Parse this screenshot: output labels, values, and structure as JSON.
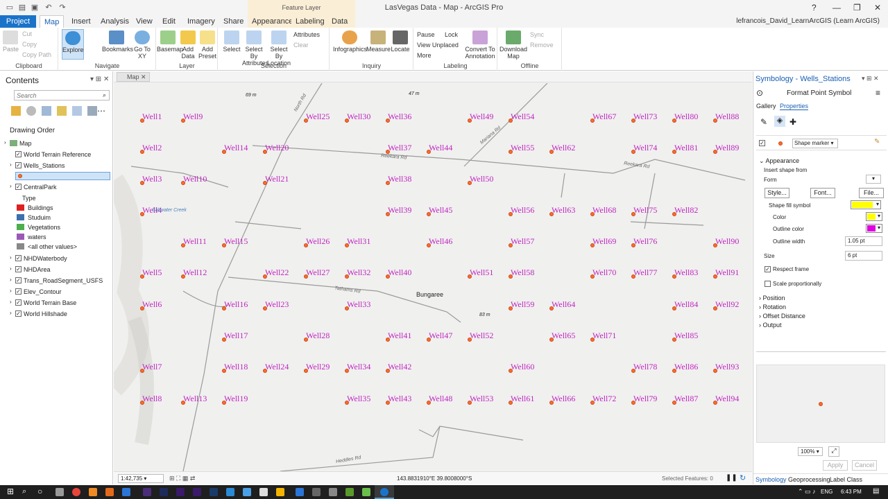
{
  "title_bar": {
    "title": "LasVegas Data - Map - ArcGIS Pro",
    "context_group": "Feature Layer",
    "help": "?",
    "minimize": "—",
    "restore": "❐",
    "close": "✕"
  },
  "tabs": [
    {
      "label": "Project"
    },
    {
      "label": "Map"
    },
    {
      "label": "Insert"
    },
    {
      "label": "Analysis"
    },
    {
      "label": "View"
    },
    {
      "label": "Edit"
    },
    {
      "label": "Imagery"
    },
    {
      "label": "Share"
    },
    {
      "label": "Appearance"
    },
    {
      "label": "Labeling"
    },
    {
      "label": "Data"
    }
  ],
  "user": "lefrancois_David_LearnArcGIS (Learn ArcGIS)",
  "ribbon": {
    "clipboard": {
      "paste": "Paste",
      "cut": "Cut",
      "copy": "Copy",
      "copy_path": "Copy Path",
      "label": "Clipboard"
    },
    "navigate": {
      "explore": "Explore",
      "bookmarks": "Bookmarks",
      "goto": "Go To XY",
      "label": "Navigate"
    },
    "layer": {
      "basemap": "Basemap",
      "add_data": "Add Data",
      "add_preset": "Add Preset",
      "label": "Layer"
    },
    "selection": {
      "select": "Select",
      "select_attr": "Select By Attributes",
      "select_loc": "Select By Location",
      "attributes": "Attributes",
      "clear": "Clear",
      "label": "Selection"
    },
    "inquiry": {
      "infographics": "Infographics",
      "measure": "Measure",
      "locate": "Locate",
      "label": "Inquiry"
    },
    "labeling": {
      "pause": "Pause",
      "lock": "Lock",
      "view_unplaced": "View Unplaced",
      "more": "More",
      "convert": "Convert To Annotation",
      "label": "Labeling"
    },
    "offline": {
      "download": "Download Map",
      "sync": "Sync",
      "remove": "Remove",
      "label": "Offline"
    }
  },
  "contents": {
    "title": "Contents",
    "search_placeholder": "Search",
    "drawing_order": "Drawing Order",
    "layers": [
      {
        "name": "Map"
      },
      {
        "name": "World Terrain Reference"
      },
      {
        "name": "Wells_Stations"
      },
      {
        "name": "CentralPark"
      },
      {
        "name": "Type"
      },
      {
        "name": "Buildings",
        "color": "#e02020"
      },
      {
        "name": "Studuim",
        "color": "#3b6fb0"
      },
      {
        "name": "Vegetations",
        "color": "#4caf4c"
      },
      {
        "name": "waters",
        "color": "#9b59b6"
      },
      {
        "name": "<all other values>",
        "color": "#888888"
      },
      {
        "name": "NHDWaterbody"
      },
      {
        "name": "NHDArea"
      },
      {
        "name": "Trans_RoadSegment_USFS"
      },
      {
        "name": "Elev_Contour"
      },
      {
        "name": "World Terrain Base"
      },
      {
        "name": "World Hillshade"
      }
    ]
  },
  "map": {
    "tab": "Map",
    "place": "Bungaree",
    "scale": "1:42,735",
    "coords": "143.8831910°E 39.8008000°S",
    "selected": "Selected Features: 0",
    "roads": [
      {
        "name": "Reekara Rd"
      },
      {
        "name": "Reekara Rd"
      },
      {
        "name": "Tathams Rd"
      },
      {
        "name": "Heddles Rd"
      },
      {
        "name": "North Rd"
      },
      {
        "name": "Mariana Rd"
      },
      {
        "name": "Saltwater Creek"
      }
    ],
    "elevations": [
      {
        "label": "69 m"
      },
      {
        "label": "47 m"
      },
      {
        "label": "83 m"
      }
    ],
    "wells": [
      {
        "l": "Well1",
        "c": 0,
        "r": 0
      },
      {
        "l": "Well9",
        "c": 1,
        "r": 0
      },
      {
        "l": "Well25",
        "c": 4,
        "r": 0
      },
      {
        "l": "Well30",
        "c": 5,
        "r": 0
      },
      {
        "l": "Well36",
        "c": 6,
        "r": 0
      },
      {
        "l": "Well49",
        "c": 8,
        "r": 0
      },
      {
        "l": "Well54",
        "c": 9,
        "r": 0
      },
      {
        "l": "Well67",
        "c": 11,
        "r": 0
      },
      {
        "l": "Well73",
        "c": 12,
        "r": 0
      },
      {
        "l": "Well80",
        "c": 13,
        "r": 0
      },
      {
        "l": "Well88",
        "c": 14,
        "r": 0
      },
      {
        "l": "Well2",
        "c": 0,
        "r": 1
      },
      {
        "l": "Well14",
        "c": 2,
        "r": 1
      },
      {
        "l": "Well20",
        "c": 3,
        "r": 1
      },
      {
        "l": "Well37",
        "c": 6,
        "r": 1
      },
      {
        "l": "Well44",
        "c": 7,
        "r": 1
      },
      {
        "l": "Well55",
        "c": 9,
        "r": 1
      },
      {
        "l": "Well62",
        "c": 10,
        "r": 1
      },
      {
        "l": "Well74",
        "c": 12,
        "r": 1
      },
      {
        "l": "Well81",
        "c": 13,
        "r": 1
      },
      {
        "l": "Well89",
        "c": 14,
        "r": 1
      },
      {
        "l": "Well3",
        "c": 0,
        "r": 2
      },
      {
        "l": "Well10",
        "c": 1,
        "r": 2
      },
      {
        "l": "Well21",
        "c": 3,
        "r": 2
      },
      {
        "l": "Well38",
        "c": 6,
        "r": 2
      },
      {
        "l": "Well50",
        "c": 8,
        "r": 2
      },
      {
        "l": "Well4",
        "c": 0,
        "r": 3
      },
      {
        "l": "Well39",
        "c": 6,
        "r": 3
      },
      {
        "l": "Well45",
        "c": 7,
        "r": 3
      },
      {
        "l": "Well56",
        "c": 9,
        "r": 3
      },
      {
        "l": "Well63",
        "c": 10,
        "r": 3
      },
      {
        "l": "Well68",
        "c": 11,
        "r": 3
      },
      {
        "l": "Well75",
        "c": 12,
        "r": 3
      },
      {
        "l": "Well82",
        "c": 13,
        "r": 3
      },
      {
        "l": "Well11",
        "c": 1,
        "r": 4
      },
      {
        "l": "Well15",
        "c": 2,
        "r": 4
      },
      {
        "l": "Well26",
        "c": 4,
        "r": 4
      },
      {
        "l": "Well31",
        "c": 5,
        "r": 4
      },
      {
        "l": "Well46",
        "c": 7,
        "r": 4
      },
      {
        "l": "Well57",
        "c": 9,
        "r": 4
      },
      {
        "l": "Well69",
        "c": 11,
        "r": 4
      },
      {
        "l": "Well76",
        "c": 12,
        "r": 4
      },
      {
        "l": "Well90",
        "c": 14,
        "r": 4
      },
      {
        "l": "Well5",
        "c": 0,
        "r": 5
      },
      {
        "l": "Well12",
        "c": 1,
        "r": 5
      },
      {
        "l": "Well22",
        "c": 3,
        "r": 5
      },
      {
        "l": "Well27",
        "c": 4,
        "r": 5
      },
      {
        "l": "Well32",
        "c": 5,
        "r": 5
      },
      {
        "l": "Well40",
        "c": 6,
        "r": 5
      },
      {
        "l": "Well51",
        "c": 8,
        "r": 5
      },
      {
        "l": "Well58",
        "c": 9,
        "r": 5
      },
      {
        "l": "Well70",
        "c": 11,
        "r": 5
      },
      {
        "l": "Well77",
        "c": 12,
        "r": 5
      },
      {
        "l": "Well83",
        "c": 13,
        "r": 5
      },
      {
        "l": "Well91",
        "c": 14,
        "r": 5
      },
      {
        "l": "Well6",
        "c": 0,
        "r": 6
      },
      {
        "l": "Well16",
        "c": 2,
        "r": 6
      },
      {
        "l": "Well23",
        "c": 3,
        "r": 6
      },
      {
        "l": "Well33",
        "c": 5,
        "r": 6
      },
      {
        "l": "Well59",
        "c": 9,
        "r": 6
      },
      {
        "l": "Well64",
        "c": 10,
        "r": 6
      },
      {
        "l": "Well84",
        "c": 13,
        "r": 6
      },
      {
        "l": "Well92",
        "c": 14,
        "r": 6
      },
      {
        "l": "Well17",
        "c": 2,
        "r": 7
      },
      {
        "l": "Well28",
        "c": 4,
        "r": 7
      },
      {
        "l": "Well41",
        "c": 6,
        "r": 7
      },
      {
        "l": "Well47",
        "c": 7,
        "r": 7
      },
      {
        "l": "Well52",
        "c": 8,
        "r": 7
      },
      {
        "l": "Well65",
        "c": 10,
        "r": 7
      },
      {
        "l": "Well71",
        "c": 11,
        "r": 7
      },
      {
        "l": "Well85",
        "c": 13,
        "r": 7
      },
      {
        "l": "Well7",
        "c": 0,
        "r": 8
      },
      {
        "l": "Well18",
        "c": 2,
        "r": 8
      },
      {
        "l": "Well24",
        "c": 3,
        "r": 8
      },
      {
        "l": "Well29",
        "c": 4,
        "r": 8
      },
      {
        "l": "Well34",
        "c": 5,
        "r": 8
      },
      {
        "l": "Well42",
        "c": 6,
        "r": 8
      },
      {
        "l": "Well60",
        "c": 9,
        "r": 8
      },
      {
        "l": "Well78",
        "c": 12,
        "r": 8
      },
      {
        "l": "Well86",
        "c": 13,
        "r": 8
      },
      {
        "l": "Well93",
        "c": 14,
        "r": 8
      },
      {
        "l": "Well8",
        "c": 0,
        "r": 9
      },
      {
        "l": "Well13",
        "c": 1,
        "r": 9
      },
      {
        "l": "Well19",
        "c": 2,
        "r": 9
      },
      {
        "l": "Well35",
        "c": 5,
        "r": 9
      },
      {
        "l": "Well43",
        "c": 6,
        "r": 9
      },
      {
        "l": "Well48",
        "c": 7,
        "r": 9
      },
      {
        "l": "Well53",
        "c": 8,
        "r": 9
      },
      {
        "l": "Well61",
        "c": 9,
        "r": 9
      },
      {
        "l": "Well66",
        "c": 10,
        "r": 9
      },
      {
        "l": "Well72",
        "c": 11,
        "r": 9
      },
      {
        "l": "Well79",
        "c": 12,
        "r": 9
      },
      {
        "l": "Well87",
        "c": 13,
        "r": 9
      },
      {
        "l": "Well94",
        "c": 14,
        "r": 9
      }
    ]
  },
  "symbology": {
    "title": "Symbology - Wells_Stations",
    "subtitle": "Format Point Symbol",
    "tab_gallery": "Gallery",
    "tab_properties": "Properties",
    "layer_select": "Shape marker",
    "appearance": "Appearance",
    "insert_shape": "Insert shape from",
    "form": "Form",
    "style_btn": "Style...",
    "font_btn": "Font...",
    "file_btn": "File...",
    "fill_symbol": "Shape fill symbol",
    "color": "Color",
    "outline_color": "Outline color",
    "outline_width": "Outline width",
    "outline_width_value": "1.05 pt",
    "size": "Size",
    "size_value": "6 pt",
    "respect_frame": "Respect frame",
    "scale_prop": "Scale proportionally",
    "position": "Position",
    "rotation": "Rotation",
    "offset": "Offset Distance",
    "output": "Output",
    "zoom": "100%",
    "apply": "Apply",
    "cancel": "Cancel",
    "fill_color": "#ffff00",
    "outline_color_value": "#e000e0"
  },
  "bottom_tabs": [
    {
      "label": "Symbology"
    },
    {
      "label": "Geoprocessing"
    },
    {
      "label": "Label Class"
    }
  ],
  "taskbar": {
    "lang": "ENG",
    "time": "6:43 PM"
  }
}
